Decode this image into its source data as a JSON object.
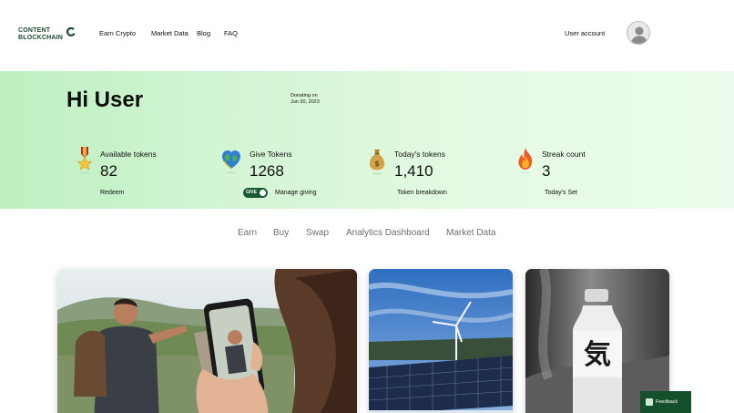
{
  "header": {
    "logo_line1": "CONTENT",
    "logo_line2": "BLOCKCHAIN",
    "nav": {
      "earn_crypto": "Earn Crypto",
      "market_data": "Market Data",
      "blog": "Blog",
      "faq": "FAQ"
    },
    "user_account": "User account",
    "brand_color": "#1c4a2e"
  },
  "hero": {
    "greeting": "Hi User",
    "stats": {
      "available": {
        "label": "Available tokens",
        "value": "82",
        "link": "Redeem",
        "icon": "medal-icon"
      },
      "give": {
        "label": "Give Tokens",
        "value": "1268",
        "donating_line1": "Donating on",
        "donating_line2": "Jun 30, 2023",
        "toggle_label": "GIVE",
        "link": "Manage giving",
        "icon": "heart-globe-icon"
      },
      "today": {
        "label": "Today's tokens",
        "value": "1,410",
        "link": "Token breakdown",
        "icon": "money-bag-icon"
      },
      "streak": {
        "label": "Streak count",
        "value": "3",
        "link": "Today's Set",
        "icon": "fire-icon"
      }
    }
  },
  "tabs": [
    "Earn",
    "Buy",
    "Swap",
    "Analytics Dashboard",
    "Market Data"
  ],
  "feedback": {
    "label": "Feedback"
  }
}
